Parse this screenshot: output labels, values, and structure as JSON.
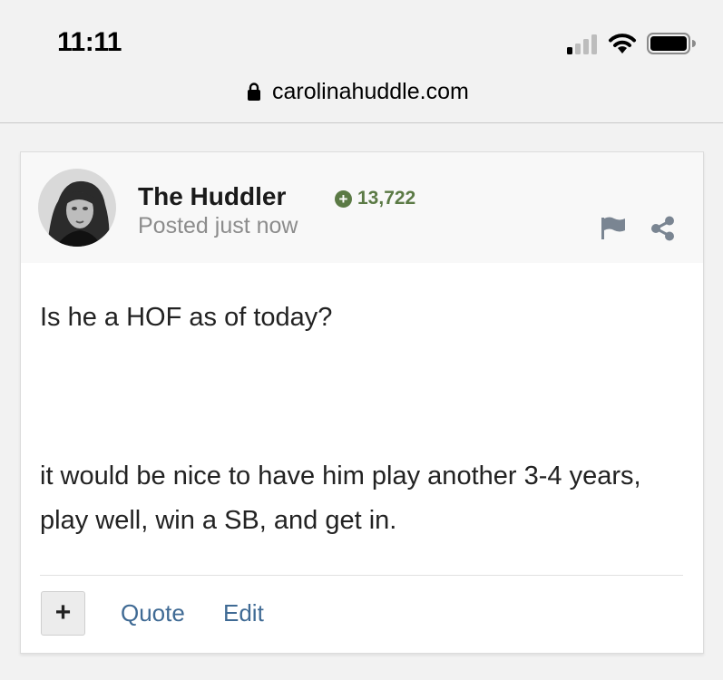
{
  "status_bar": {
    "time": "11:11"
  },
  "browser": {
    "url": "carolinahuddle.com"
  },
  "post": {
    "author": "The Huddler",
    "reputation": "13,722",
    "posted": "Posted just now",
    "content": [
      "Is he a HOF as of today?",
      "it would be nice to have him play another 3-4 years, play well, win a SB, and get in."
    ],
    "actions": {
      "plus": "+",
      "quote": "Quote",
      "edit": "Edit"
    }
  },
  "colors": {
    "reputation": "#5b7a45",
    "link": "#3f6a94",
    "header_bg": "#f8f8f8"
  },
  "icons": [
    "signal-icon",
    "wifi-icon",
    "battery-icon",
    "lock-icon",
    "avatar",
    "reputation-plus-icon",
    "flag-icon",
    "share-icon"
  ]
}
